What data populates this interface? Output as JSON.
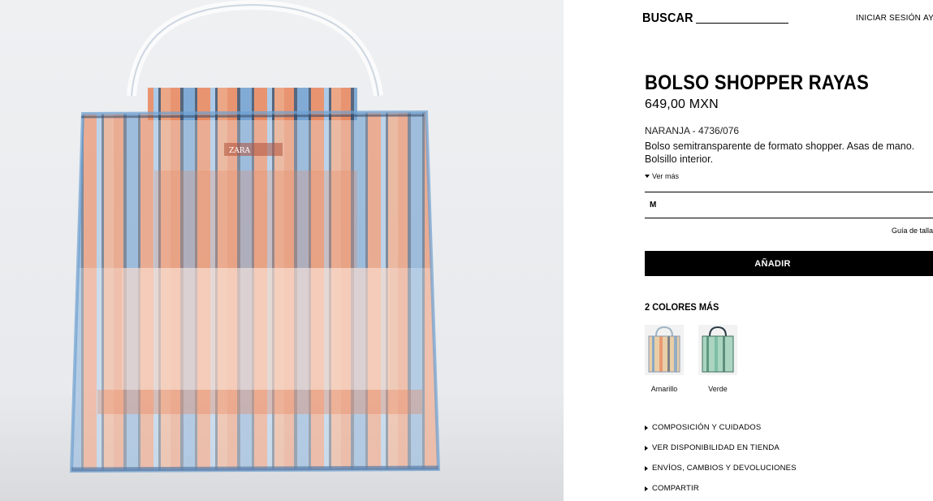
{
  "header": {
    "search_label": "BUSCAR",
    "login_label": "INICIAR SESIÓN",
    "help_label": "AY"
  },
  "product": {
    "title": "BOLSO SHOPPER RAYAS",
    "price": "649,00 MXN",
    "color_ref": "NARANJA - 4736/076",
    "description": "Bolso semitransparente de formato shopper. Asas de mano. Bolsillo interior.",
    "see_more": "Ver más",
    "brand_tag": "ZARA"
  },
  "size": {
    "selected": "M",
    "guide_label": "Guía de talla"
  },
  "add_button_label": "AÑADIR",
  "more_colors": {
    "title": "2 COLORES MÁS",
    "options": [
      {
        "label": "Amarillo"
      },
      {
        "label": "Verde"
      }
    ]
  },
  "accordions": [
    {
      "label": "COMPOSICIÓN Y CUIDADOS"
    },
    {
      "label": "VER DISPONIBILIDAD EN TIENDA"
    },
    {
      "label": "ENVÍOS, CAMBIOS Y DEVOLUCIONES"
    },
    {
      "label": "COMPARTIR"
    }
  ],
  "colors": {
    "stripe_orange": "#e8845a",
    "stripe_blue": "#6e9fd0",
    "stripe_navy": "#3b4f6a",
    "button_black": "#000000"
  }
}
